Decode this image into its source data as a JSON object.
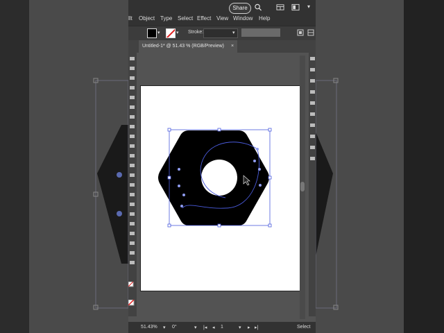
{
  "menubar": {
    "items": [
      "llt",
      "Object",
      "Type",
      "Select",
      "Effect",
      "View",
      "Window",
      "Help"
    ],
    "share_label": "Share"
  },
  "control_bar": {
    "stroke_label": "Stroke:"
  },
  "document_tab": {
    "title": "Untitled-1* @ 51.43 % (RGB/Preview)",
    "close_glyph": "×"
  },
  "status_bar": {
    "zoom": "51.43%",
    "rotation": "0°",
    "artboard_number": "1",
    "tool_name": "Select"
  },
  "colors": {
    "fill": "#000000",
    "selection": "#4a5bdc",
    "artboard": "#ffffff",
    "pasteboard": "#535353"
  },
  "icons": [
    "search-icon",
    "workspace-icon",
    "arrange-icon",
    "cursor-icon"
  ]
}
